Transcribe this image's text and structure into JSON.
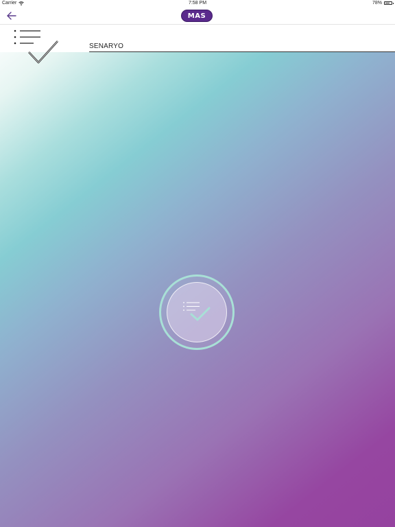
{
  "status_bar": {
    "carrier": "Carrier",
    "time": "7:58 PM",
    "battery_label": "78%",
    "battery_level": 0.78
  },
  "nav": {
    "logo_text": "MAS",
    "back_icon": "arrow-left-icon"
  },
  "header": {
    "icon": "checklist-icon",
    "title": "SENARYO"
  },
  "center_button": {
    "icon": "checklist-icon"
  },
  "colors": {
    "logo_bg": "#5a2a8c",
    "ring": "#a8e0d6",
    "gradient_teal": "#86cdd3",
    "gradient_purple": "#95429f"
  }
}
